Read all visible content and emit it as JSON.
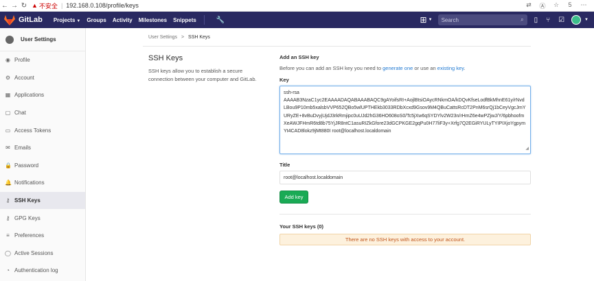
{
  "browser": {
    "back": "←",
    "forward": "→",
    "reload": "↻",
    "warning_icon": "warning-triangle",
    "security_text": "不安全",
    "url": "192.168.0.108/profile/keys",
    "tab_count": "5"
  },
  "header": {
    "brand": "GitLab",
    "nav": [
      "Projects",
      "Groups",
      "Activity",
      "Milestones",
      "Snippets"
    ],
    "search_placeholder": "Search",
    "colors": {
      "header_bg": "#292961",
      "logo": "#fc6d26"
    }
  },
  "sidebar": {
    "title": "User Settings",
    "items": [
      {
        "label": "Profile",
        "icon": "profile-icon",
        "glyph": "◉"
      },
      {
        "label": "Account",
        "icon": "gear-icon",
        "glyph": "⚙"
      },
      {
        "label": "Applications",
        "icon": "applications-icon",
        "glyph": "▦"
      },
      {
        "label": "Chat",
        "icon": "chat-icon",
        "glyph": "▢"
      },
      {
        "label": "Access Tokens",
        "icon": "token-icon",
        "glyph": "▭"
      },
      {
        "label": "Emails",
        "icon": "mail-icon",
        "glyph": "✉"
      },
      {
        "label": "Password",
        "icon": "lock-icon",
        "glyph": "🔒"
      },
      {
        "label": "Notifications",
        "icon": "bell-icon",
        "glyph": "🔔"
      },
      {
        "label": "SSH Keys",
        "icon": "key-icon",
        "glyph": "⚷",
        "active": true
      },
      {
        "label": "GPG Keys",
        "icon": "gpg-key-icon",
        "glyph": "⚷"
      },
      {
        "label": "Preferences",
        "icon": "preferences-icon",
        "glyph": "≡"
      },
      {
        "label": "Active Sessions",
        "icon": "sessions-icon",
        "glyph": "◯"
      },
      {
        "label": "Authentication log",
        "icon": "log-icon",
        "glyph": "◔"
      }
    ]
  },
  "breadcrumb": {
    "parent": "User Settings",
    "separator": ">",
    "current": "SSH Keys"
  },
  "intro": {
    "title": "SSH Keys",
    "description": "SSH keys allow you to establish a secure connection between your computer and GitLab."
  },
  "form": {
    "heading": "Add an SSH key",
    "desc_prefix": "Before you can add an SSH key you need to ",
    "generate_link": "generate one",
    "desc_middle": " or use an ",
    "existing_link": "existing key",
    "desc_suffix": ".",
    "key_label": "Key",
    "key_value": "ssh-rsa\nAAAAB3NzaC1yc2EAAAADAQABAAABAQC9gAYoifsRI+AojlBtsiOAycRNkmOA/kDQvKfseLodfBkMhnE61y/rNvdLBou9P10mb5xalsbVVP652QBo5wlUPTHEkb3033RDbXcxd9Gsov9M4QBuCattsRcDT2PnM6srQj1bCeyVgcJmYURyZE+8vBuDvyjUjdJ3rkRmjipc0uUJd2hG36HO608oS0/Tc5jXw6qSYDYlv2W23n/rHmZ6e4wPZjwJ/Y/6pbhoofmXeAWJFHmR6td8b75YjJR8ntC1asuRIZkGfore23dGCPKGE2gqPu0H77liF3y+Xrfg7Q2EGiRYULyTYIPIXjoYgpymYt4CAD8lokz9jMt880I root@localhost.localdomain",
    "title_label": "Title",
    "title_value": "root@localhost.localdomain",
    "add_button": "Add key",
    "colors": {
      "add_button": "#1aaa55",
      "link": "#1f78d1"
    }
  },
  "your_keys": {
    "heading": "Your SSH keys (0)",
    "empty_message": "There are no SSH keys with access to your account.",
    "colors": {
      "empty_bg": "#fdf1dd",
      "empty_text": "#c0541a"
    }
  }
}
